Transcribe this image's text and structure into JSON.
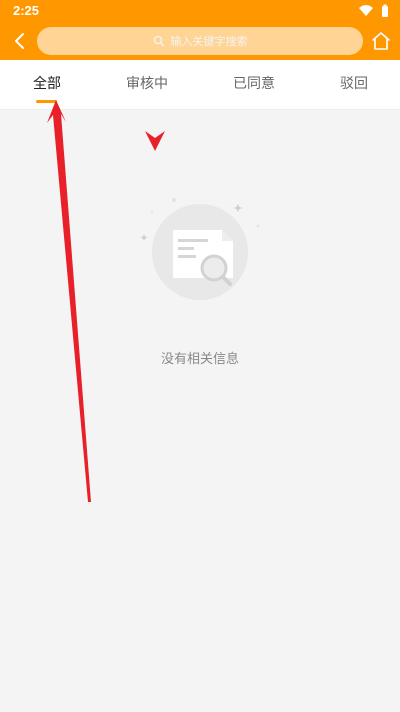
{
  "status_bar": {
    "time": "2:25",
    "icons": [
      "wifi-icon",
      "battery-icon"
    ]
  },
  "app_bar": {
    "back_icon": "chevron-left-icon",
    "search_placeholder": "输入关键字搜索",
    "home_icon": "home-icon"
  },
  "tabs": [
    {
      "label": "全部",
      "active": true
    },
    {
      "label": "审核中",
      "active": false
    },
    {
      "label": "已同意",
      "active": false
    },
    {
      "label": "驳回",
      "active": false
    }
  ],
  "empty_state": {
    "illustration": "document-search-icon",
    "message": "没有相关信息"
  },
  "colors": {
    "brand": "#ff9800",
    "annotation": "#e8202a",
    "background": "#f4f4f4"
  }
}
